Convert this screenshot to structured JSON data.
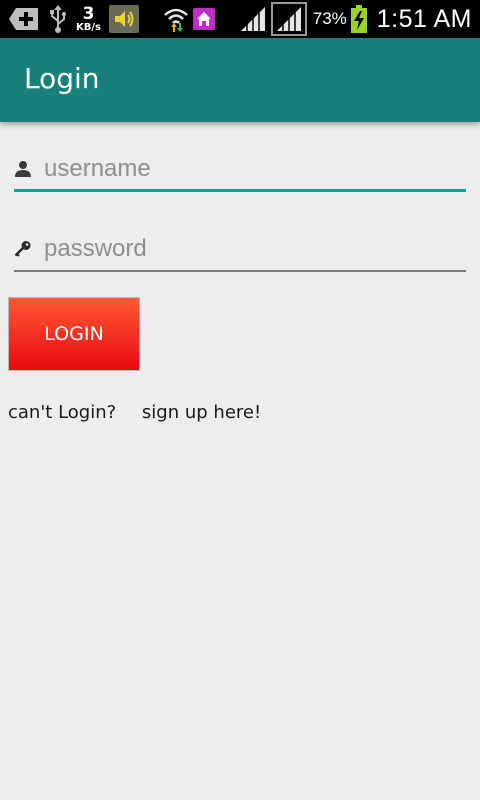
{
  "status_bar": {
    "speed_value": "3",
    "speed_unit": "KB/s",
    "battery_percent": "73%",
    "time": "1:51 AM"
  },
  "app_bar": {
    "title": "Login"
  },
  "form": {
    "username_placeholder": "username",
    "password_placeholder": "password",
    "login_label": "LOGIN"
  },
  "links": {
    "cant_login": "can't Login?",
    "signup": "sign up here!"
  },
  "colors": {
    "app_bar": "#178079",
    "accent": "#179f93",
    "login_button_top": "#ff5a33",
    "login_button_bottom": "#e60a13",
    "background": "#ededed"
  },
  "icons": {
    "username": "person-icon",
    "password": "key-icon"
  }
}
